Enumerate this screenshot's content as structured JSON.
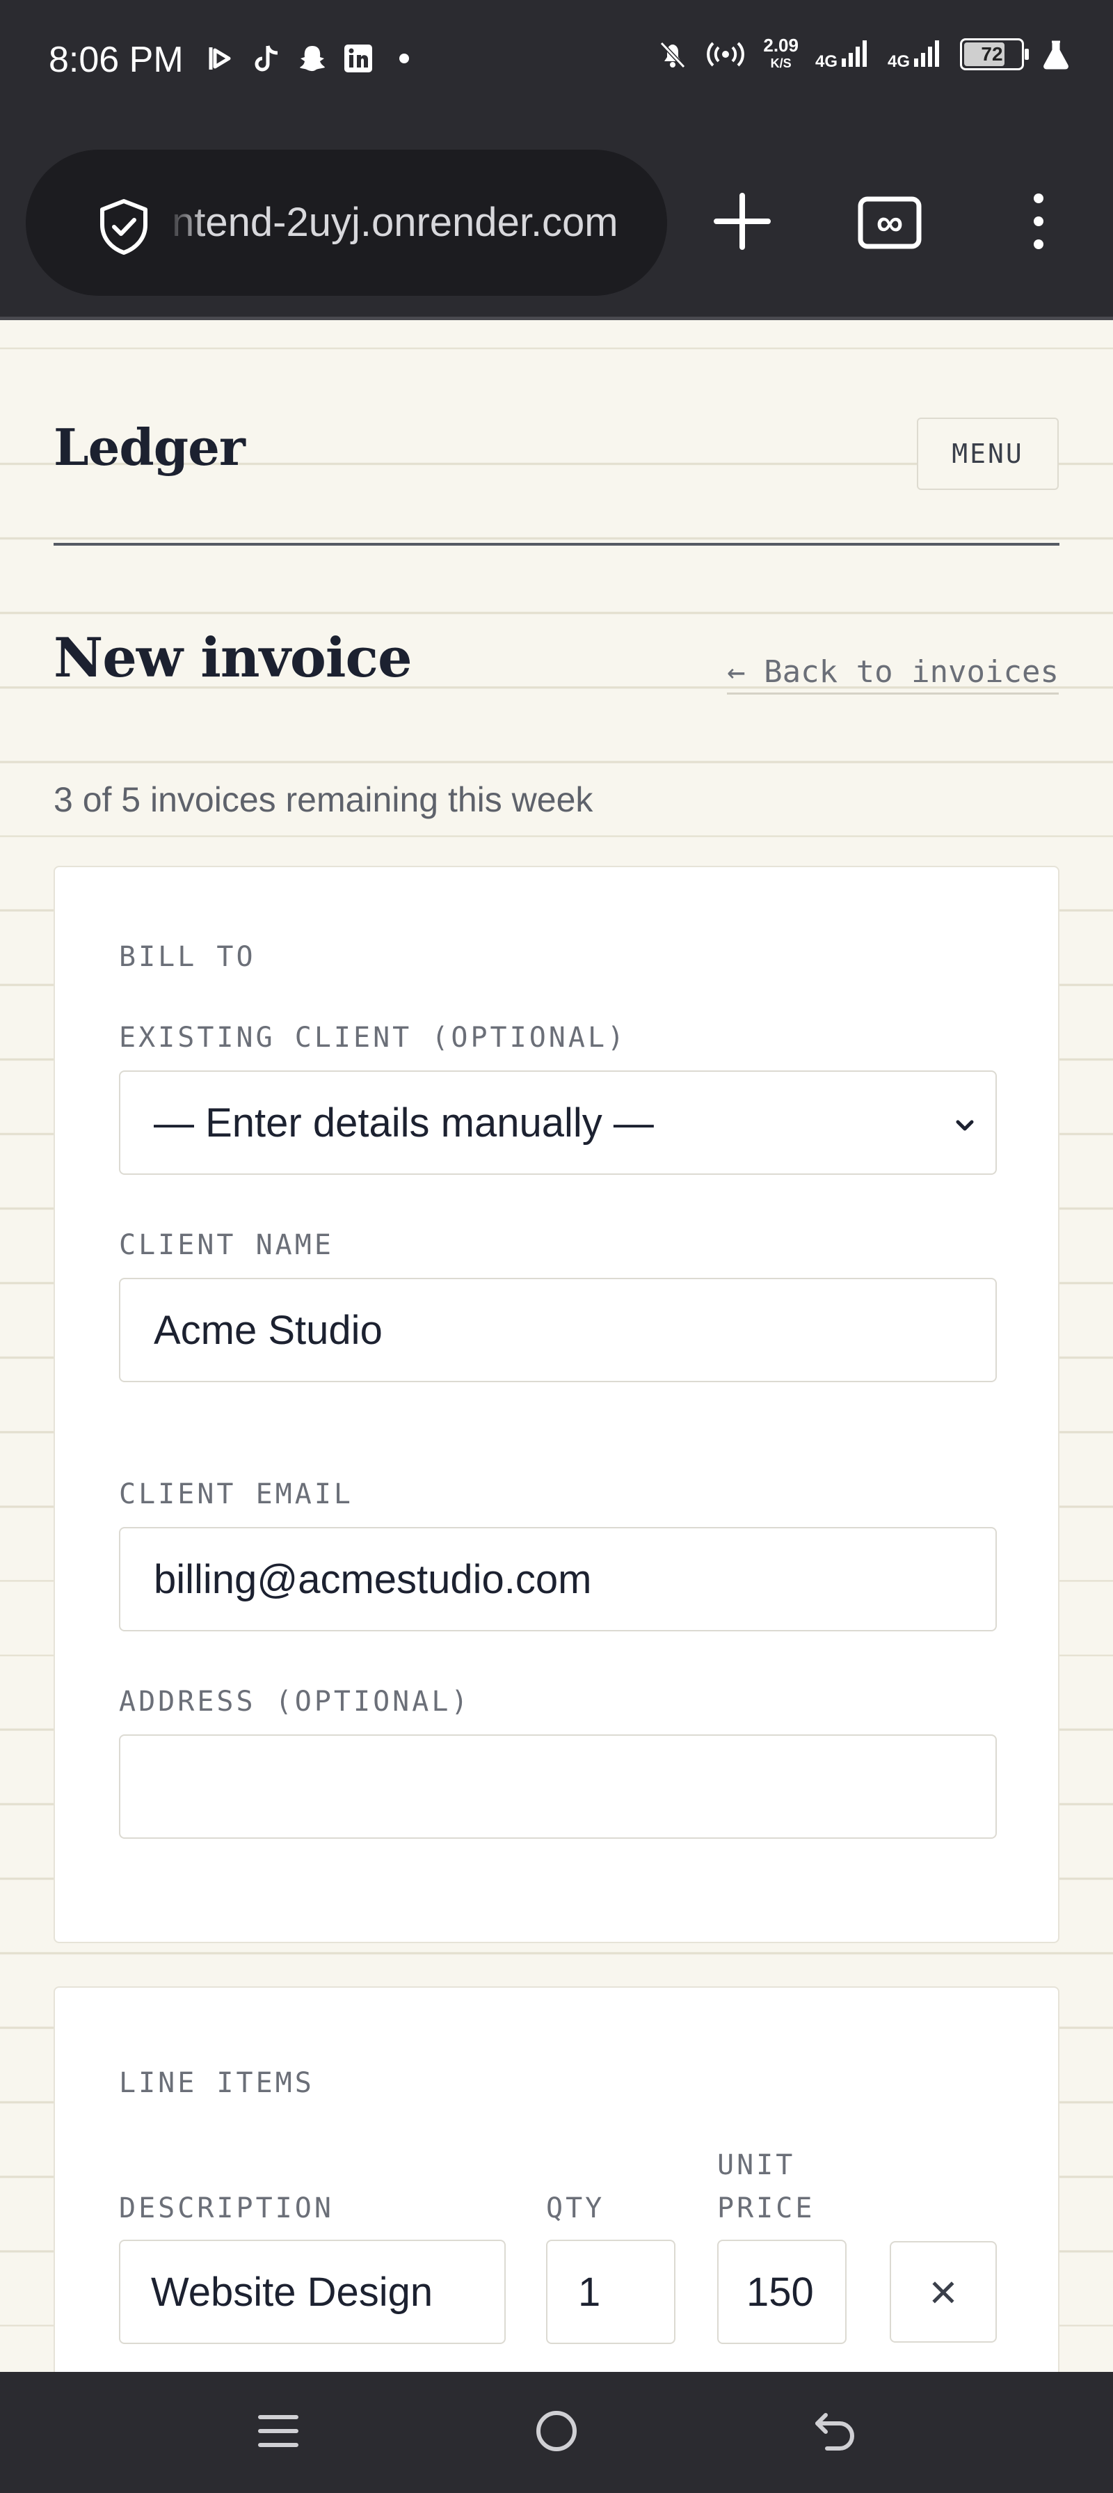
{
  "status_bar": {
    "time": "8:06 PM",
    "net_speed_value": "2.09",
    "net_speed_unit": "K/S",
    "network_1": "4G",
    "network_2": "4G",
    "battery_percent": "72",
    "battery_level": 0.72,
    "icons": [
      "play-icon",
      "tiktok-icon",
      "snapchat-icon",
      "linkedin-icon",
      "dot-icon",
      "bell-off-icon",
      "hotspot-icon",
      "signal-icon",
      "signal-icon",
      "battery-icon",
      "flask-icon"
    ]
  },
  "browser": {
    "url": "ntend-2uyj.onrender.com",
    "icons": [
      "shield-icon",
      "new-tab-icon",
      "tab-switcher-icon",
      "more-menu-icon"
    ],
    "tab_count_symbol": "∞"
  },
  "header": {
    "brand": "Ledger",
    "menu_label": "MENU"
  },
  "main": {
    "title": "New invoice",
    "back_link": "← Back to invoices",
    "remaining_text": "3 of 5 invoices remaining this week"
  },
  "bill_to": {
    "section_label": "BILL TO",
    "existing_client_label": "EXISTING CLIENT (OPTIONAL)",
    "existing_client_value": "— Enter details manually —",
    "client_name_label": "CLIENT NAME",
    "client_name_value": "Acme Studio",
    "client_email_label": "CLIENT EMAIL",
    "client_email_value": "billing@acmestudio.com",
    "address_label": "ADDRESS (OPTIONAL)",
    "address_value": ""
  },
  "line_items": {
    "section_label": "LINE ITEMS",
    "columns": {
      "description": "DESCRIPTION",
      "qty": "QTY",
      "unit_price_line1": "UNIT",
      "unit_price_line2": "PRICE"
    },
    "rows": [
      {
        "description": "Website Design",
        "qty": "1",
        "unit_price": "150"
      }
    ],
    "remove_symbol": "×"
  },
  "colors": {
    "page_background": "#f8f6ee",
    "ink": "#1c2130",
    "muted": "#6b6f78",
    "system_bar": "#2b2b30"
  }
}
